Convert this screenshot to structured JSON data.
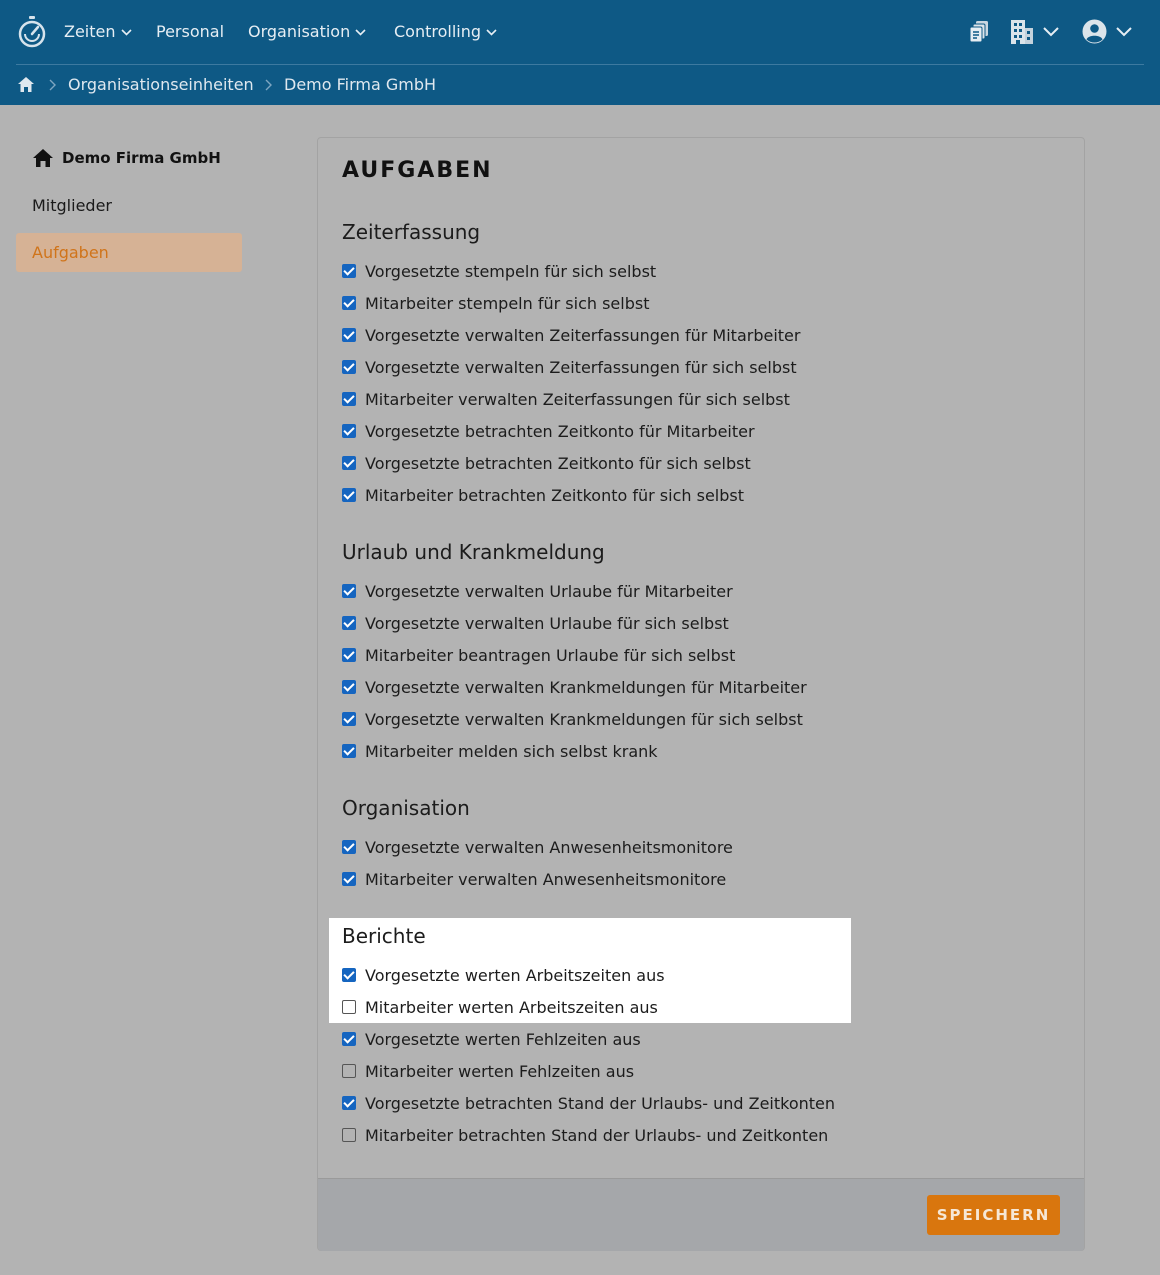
{
  "nav": {
    "items": [
      {
        "label": "Zeiten",
        "dropdown": true
      },
      {
        "label": "Personal",
        "dropdown": false
      },
      {
        "label": "Organisation",
        "dropdown": true
      },
      {
        "label": "Controlling",
        "dropdown": true
      }
    ]
  },
  "breadcrumb": {
    "items": [
      "Organisationseinheiten",
      "Demo Firma GmbH"
    ]
  },
  "sidebar": {
    "title": "Demo Firma GmbH",
    "items": [
      {
        "label": "Mitglieder",
        "active": false
      },
      {
        "label": "Aufgaben",
        "active": true
      }
    ]
  },
  "main": {
    "title": "AUFGABEN",
    "sections": [
      {
        "title": "Zeiterfassung",
        "items": [
          {
            "label": "Vorgesetzte stempeln für sich selbst",
            "checked": true
          },
          {
            "label": "Mitarbeiter stempeln für sich selbst",
            "checked": true
          },
          {
            "label": "Vorgesetzte verwalten Zeiterfassungen für Mitarbeiter",
            "checked": true
          },
          {
            "label": "Vorgesetzte verwalten Zeiterfassungen für sich selbst",
            "checked": true
          },
          {
            "label": "Mitarbeiter verwalten Zeiterfassungen für sich selbst",
            "checked": true
          },
          {
            "label": "Vorgesetzte betrachten Zeitkonto für Mitarbeiter",
            "checked": true
          },
          {
            "label": "Vorgesetzte betrachten Zeitkonto für sich selbst",
            "checked": true
          },
          {
            "label": "Mitarbeiter betrachten Zeitkonto für sich selbst",
            "checked": true
          }
        ]
      },
      {
        "title": "Urlaub und Krankmeldung",
        "items": [
          {
            "label": "Vorgesetzte verwalten Urlaube für Mitarbeiter",
            "checked": true
          },
          {
            "label": "Vorgesetzte verwalten Urlaube für sich selbst",
            "checked": true
          },
          {
            "label": "Mitarbeiter beantragen Urlaube für sich selbst",
            "checked": true
          },
          {
            "label": "Vorgesetzte verwalten Krankmeldungen für Mitarbeiter",
            "checked": true
          },
          {
            "label": "Vorgesetzte verwalten Krankmeldungen für sich selbst",
            "checked": true
          },
          {
            "label": "Mitarbeiter melden sich selbst krank",
            "checked": true
          }
        ]
      },
      {
        "title": "Organisation",
        "items": [
          {
            "label": "Vorgesetzte verwalten Anwesenheitsmonitore",
            "checked": true
          },
          {
            "label": "Mitarbeiter verwalten Anwesenheitsmonitore",
            "checked": true
          }
        ]
      },
      {
        "title": "Berichte",
        "items": [
          {
            "label": "Vorgesetzte werten Arbeitszeiten aus",
            "checked": true
          },
          {
            "label": "Mitarbeiter werten Arbeitszeiten aus",
            "checked": false
          },
          {
            "label": "Vorgesetzte werten Fehlzeiten aus",
            "checked": true
          },
          {
            "label": "Mitarbeiter werten Fehlzeiten aus",
            "checked": false
          },
          {
            "label": "Vorgesetzte betrachten Stand der Urlaubs- und Zeitkonten",
            "checked": true
          },
          {
            "label": "Mitarbeiter betrachten Stand der Urlaubs- und Zeitkonten",
            "checked": false
          }
        ]
      }
    ],
    "save_label": "SPEICHERN"
  },
  "colors": {
    "header": "#0e5985",
    "accent": "#d9760e",
    "checkbox": "#1565c0",
    "sidebar_active_bg": "#d6b295",
    "spotlight": "#ffffff",
    "backdrop": "#b3b3b3"
  },
  "icons": {
    "logo": "stopwatch-logo-icon",
    "docs": "documents-icon",
    "building": "building-icon",
    "user": "user-circle-icon",
    "home": "home-icon"
  }
}
